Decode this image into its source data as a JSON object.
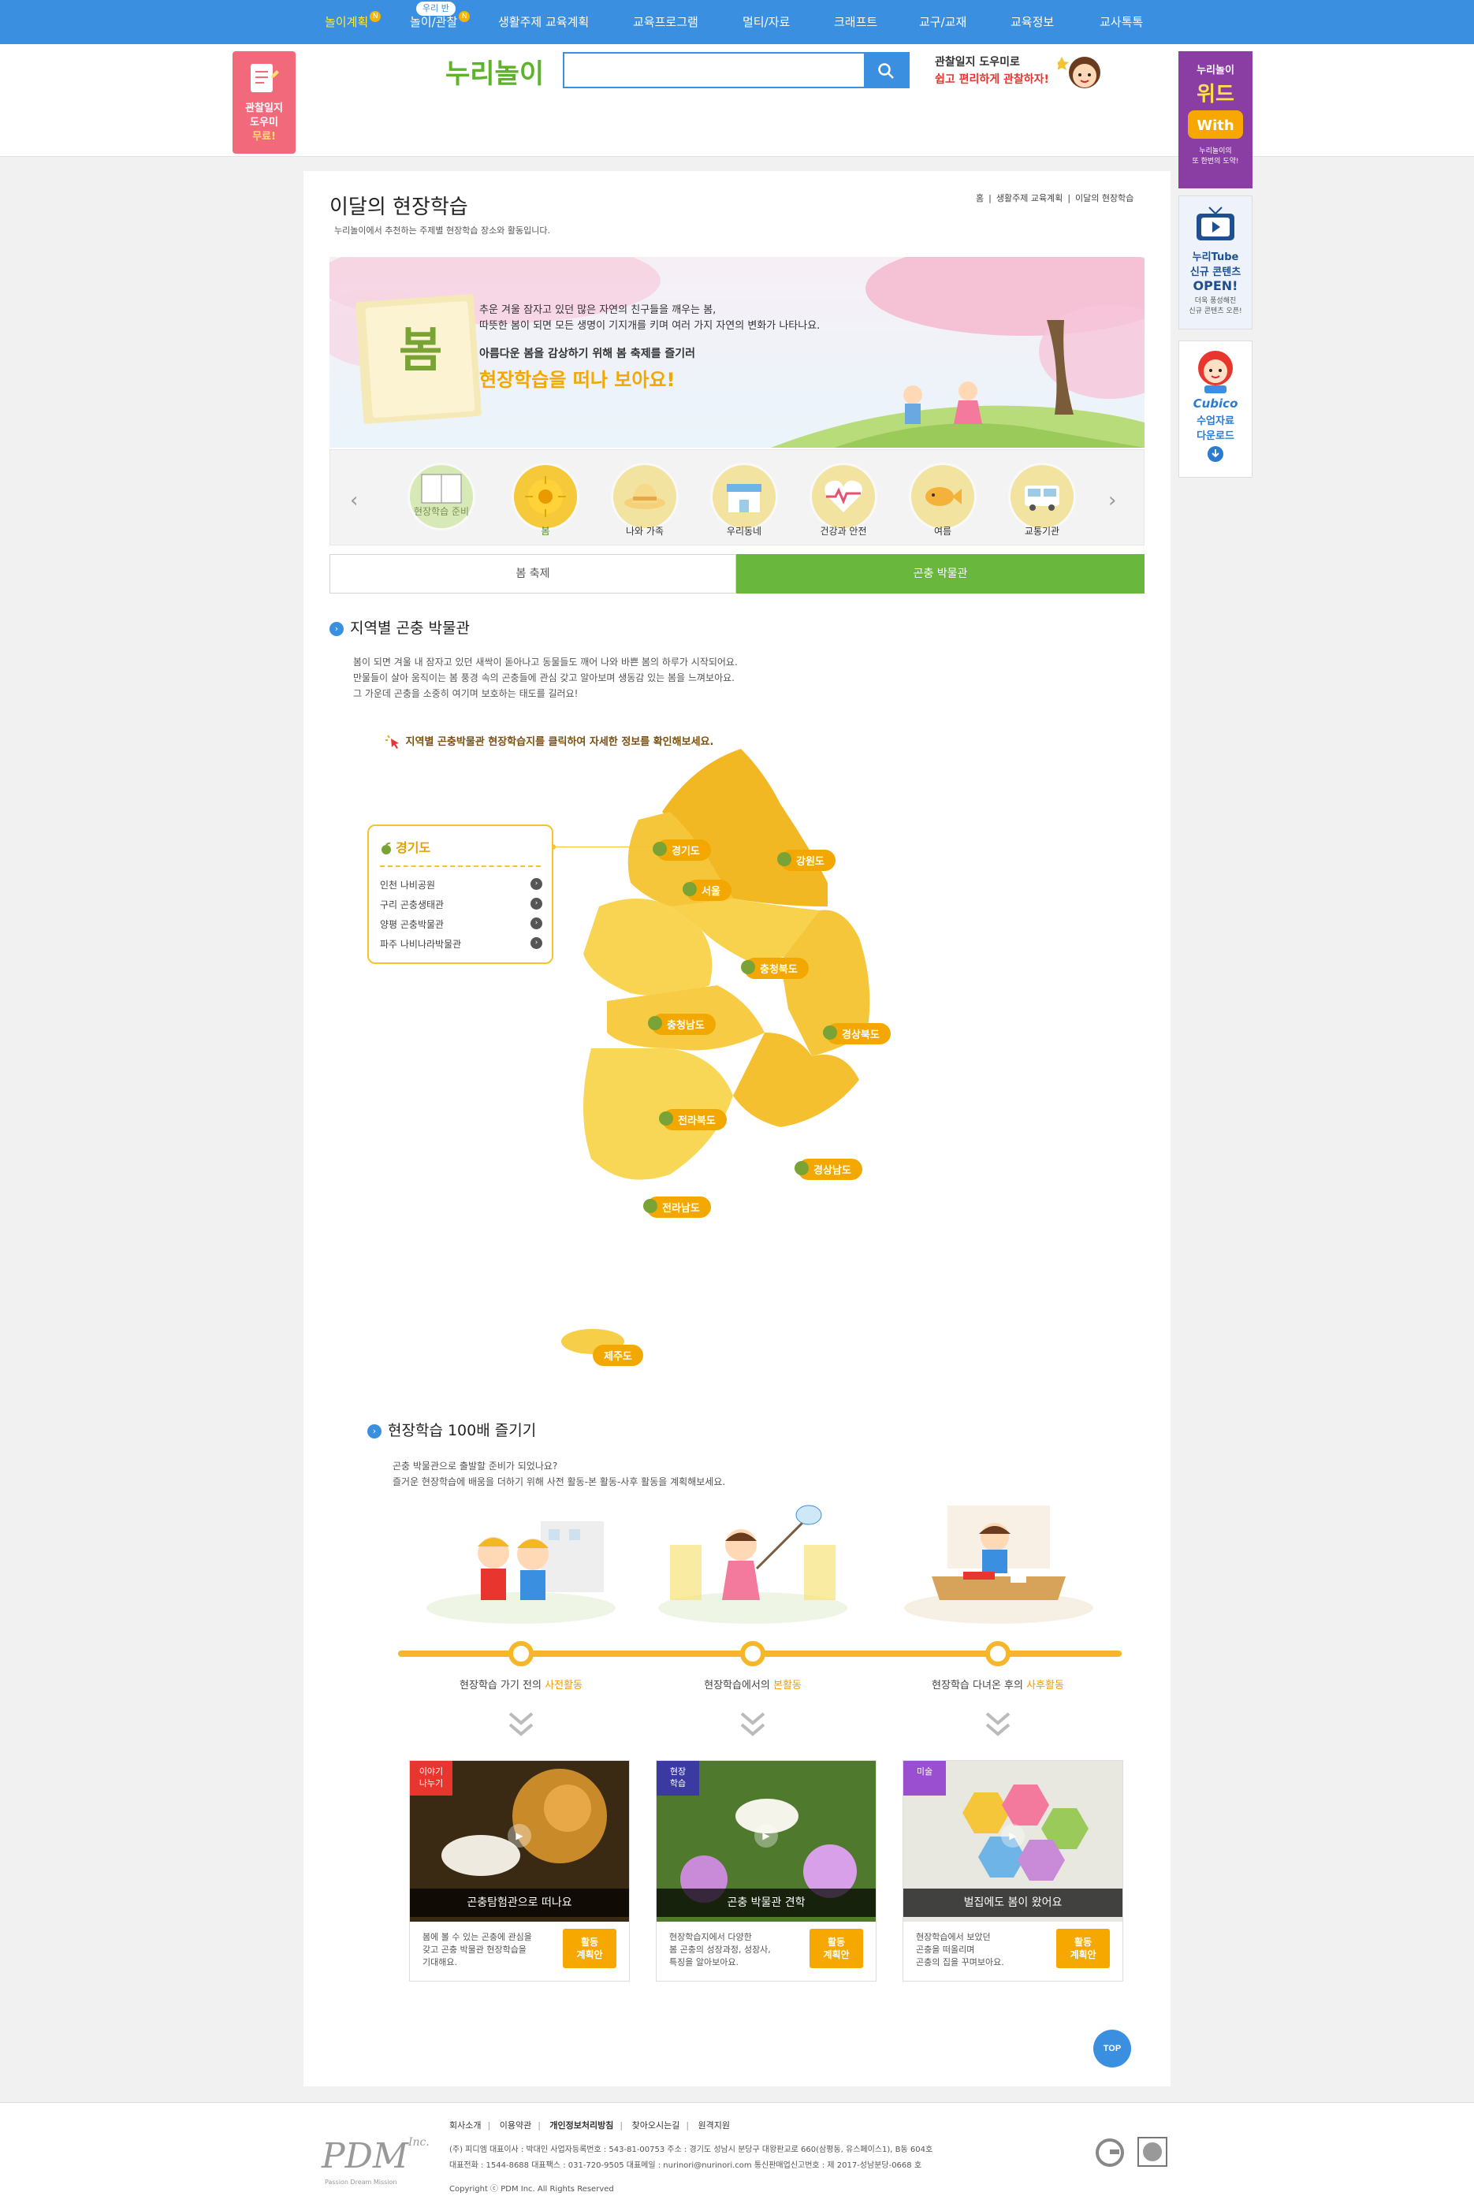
{
  "gnb": {
    "items": [
      {
        "label": "놀이계획",
        "new": "N"
      },
      {
        "label": "놀이/관찰",
        "new": "N",
        "tip": "우리 반"
      },
      {
        "label": "생활주제 교육계획"
      },
      {
        "label": "교육프로그램"
      },
      {
        "label": "멀티/자료"
      },
      {
        "label": "크래프트"
      },
      {
        "label": "교구/교재"
      },
      {
        "label": "교육정보"
      },
      {
        "label": "교사톡톡"
      }
    ]
  },
  "header": {
    "logo": "누리놀이",
    "search_placeholder": "",
    "promo_line1": "관찰일지 도우미로",
    "promo_line2": "쉽고 편리하게 관찰하자!"
  },
  "left_banner": {
    "line1": "관찰일지",
    "line2": "도우미",
    "line3": "무료!"
  },
  "right_banners": [
    {
      "title": "누리놀이",
      "big": "위드",
      "sub1": "누리놀이의",
      "sub2": "또 한번의 도약!"
    },
    {
      "title": "누리Tube",
      "big1": "신규 콘텐츠",
      "big2": "OPEN!",
      "sub1": "더욱 풍성해진",
      "sub2": "신규 콘텐츠 오픈!"
    },
    {
      "logo": "Cubico",
      "line1": "수업자료",
      "line2": "다운로드"
    }
  ],
  "page": {
    "title": "이달의 현장학습",
    "subtitle": "누리놀이에서 추천하는 주제별 현장학습 장소와 활동입니다.",
    "breadcrumb": [
      "홈",
      "생활주제 교육계획",
      "이달의 현장학습"
    ]
  },
  "banner": {
    "season": "봄",
    "line1": "추운 겨울 잠자고 있던 많은 자연의 친구들을 깨우는 봄,",
    "line2": "따뜻한 봄이 되면 모든 생명이 기지개를 키며 여러 가지 자연의 변화가 나타나요.",
    "line3": "아름다운 봄을 감상하기 위해 봄 축제를 즐기러",
    "line4": "현장학습을 떠나 보아요!"
  },
  "categories": [
    {
      "label": "현장학습 준비",
      "icon": "book-icon"
    },
    {
      "label": "봄",
      "icon": "flower-icon"
    },
    {
      "label": "나와 가족",
      "icon": "hat-icon"
    },
    {
      "label": "우리동네",
      "icon": "store-icon"
    },
    {
      "label": "건강과 안전",
      "icon": "heartbeat-icon"
    },
    {
      "label": "여름",
      "icon": "fish-icon"
    },
    {
      "label": "교통기관",
      "icon": "bus-icon"
    }
  ],
  "tabs": [
    "봄 축제",
    "곤충 박물관"
  ],
  "section1": {
    "title": "지역별 곤충 박물관",
    "p1": "봄이 되면 겨울 내 잠자고 있던 새싹이 돋아나고 동물들도 깨어 나와 바쁜 봄의 하루가 시작되어요.",
    "p2": "만물들이 살아 움직이는 봄 풍경 속의 곤충들에 관심 갖고 알아보며 생동감 있는 봄을 느껴보아요.",
    "p3": "그 가운데 곤충을 소중히 여기며 보호하는 태도를 길러요!",
    "hint": "지역별 곤충박물관 현장학습지를 클릭하여 자세한 정보를 확인해보세요."
  },
  "regions": [
    "경기도",
    "서울",
    "강원도",
    "충청북도",
    "충청남도",
    "경상북도",
    "전라북도",
    "경상남도",
    "전라남도",
    "제주도"
  ],
  "region_box": {
    "title": "경기도",
    "items": [
      "인천 나비공원",
      "구리 곤충생태관",
      "양평 곤충박물관",
      "파주 나비나라박물관"
    ]
  },
  "section2": {
    "title": "현장학습 100배 즐기기",
    "p1": "곤충 박물관으로 출발할 준비가 되었나요?",
    "p2": "즐거운 현장학습에 배움을 더하기 위해 사전 활동-본 활동-사후 활동을 계획해보세요."
  },
  "steps": [
    {
      "pre": "현장학습 가기 전의 ",
      "em": "사전활동"
    },
    {
      "pre": "현장학습에서의 ",
      "em": "본활동"
    },
    {
      "pre": "현장학습 다녀온 후의 ",
      "em": "사후활동"
    }
  ],
  "cards": [
    {
      "tag1": "이야기",
      "tag2": "나누기",
      "caption": "곤충탐험관으로 떠나요",
      "d1": "봄에 볼 수 있는 곤충에 관심을",
      "d2": "갖고 곤충 박물관 현장학습을",
      "d3": "기대해요.",
      "btn1": "활동",
      "btn2": "계획안",
      "tagcolor": "#e8362e"
    },
    {
      "tag1": "현장",
      "tag2": "학습",
      "caption": "곤충 박물관 견학",
      "d1": "현장학습지에서 다양한",
      "d2": "봄 곤충의 성장과정, 성장사,",
      "d3": "특징을 알아보아요.",
      "btn1": "활동",
      "btn2": "계획안",
      "tagcolor": "#3a3aa0"
    },
    {
      "tag1": "미술",
      "tag2": "",
      "caption": "벌집에도 봄이 왔어요",
      "d1": "현장학습에서 보았던",
      "d2": "곤충을 떠올리며",
      "d3": "곤충의 집을 꾸며보아요.",
      "btn1": "활동",
      "btn2": "계획안",
      "tagcolor": "#9a4fd0"
    }
  ],
  "top_button": "TOP",
  "footer": {
    "links": [
      "회사소개",
      "이용약관",
      "개인정보처리방침",
      "찾아오시는길",
      "원격지원"
    ],
    "line1": "(주) 피디엠  대표이사 : 박대인  사업자등록번호 : 543-81-00753  주소 : 경기도 성남시 분당구 대왕판교로 660(삼평동, 유스페이스1), B동 604호",
    "line2": "대표전화 : 1544-8688  대표팩스 : 031-720-9505  대표메일 : nurinori@nurinori.com  통신판매업신고번호 : 제 2017-성남분당-0668 호",
    "copyright": "Copyright ⓒ PDM Inc. All Rights Reserved",
    "logo": "PDM",
    "logo_sup": "Inc.",
    "logo_sub": "Passion Dream Mission"
  }
}
